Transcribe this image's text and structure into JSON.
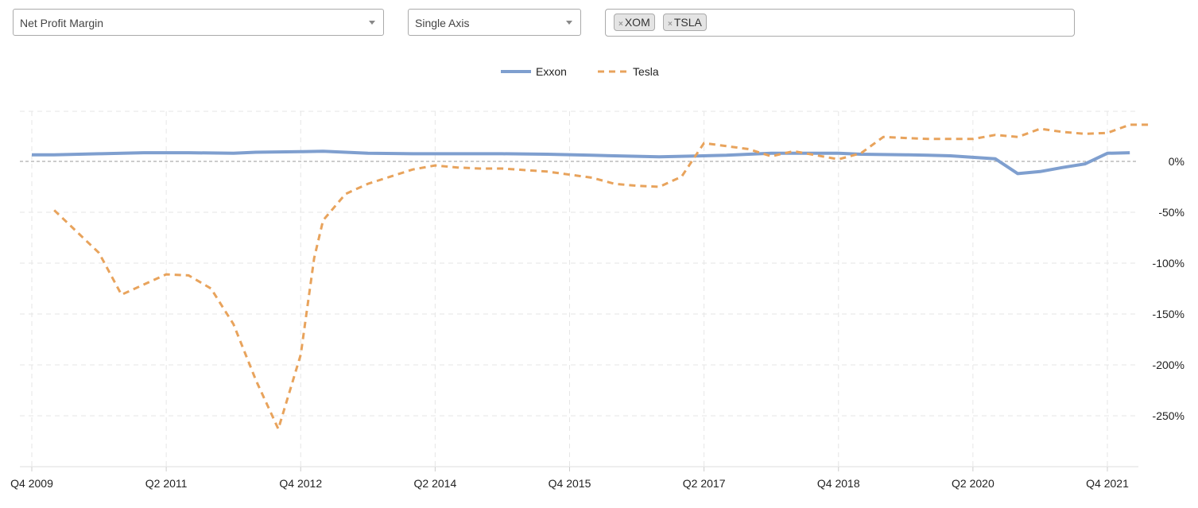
{
  "controls": {
    "metric": {
      "selected": "Net Profit Margin"
    },
    "axis_mode": {
      "selected": "Single Axis"
    },
    "tickers": [
      {
        "remove_icon": "×",
        "label": "XOM"
      },
      {
        "remove_icon": "×",
        "label": "TSLA"
      }
    ]
  },
  "chart_data": {
    "type": "line",
    "title": "",
    "xlabel": "",
    "ylabel": "",
    "legend_position": "top-center",
    "grid": true,
    "x_tick_labels": [
      "Q4 2009",
      "Q2 2011",
      "Q4 2012",
      "Q2 2014",
      "Q4 2015",
      "Q2 2017",
      "Q4 2018",
      "Q2 2020",
      "Q4 2021"
    ],
    "x_ticks": [
      2009.75,
      2011.25,
      2012.75,
      2014.25,
      2015.75,
      2017.25,
      2018.75,
      2020.25,
      2021.75
    ],
    "x_range": [
      2009.75,
      2022.0
    ],
    "y_ticks": [
      0,
      -50,
      -100,
      -150,
      -200,
      -250
    ],
    "y_tick_labels": [
      "0%",
      "-50%",
      "-100%",
      "-150%",
      "-200%",
      "-250%"
    ],
    "y_range": [
      -300,
      50
    ],
    "y_unit": "%",
    "series": [
      {
        "name": "Exxon",
        "color": "#7f9fcf",
        "style": "solid",
        "points": [
          [
            2009.75,
            6.5
          ],
          [
            2010.0,
            6.5
          ],
          [
            2010.5,
            7.5
          ],
          [
            2011.0,
            8.5
          ],
          [
            2011.25,
            8.5
          ],
          [
            2011.5,
            8.5
          ],
          [
            2012.0,
            8.0
          ],
          [
            2012.25,
            9.0
          ],
          [
            2012.75,
            9.5
          ],
          [
            2013.0,
            10.0
          ],
          [
            2013.5,
            8.0
          ],
          [
            2014.0,
            7.5
          ],
          [
            2014.5,
            7.5
          ],
          [
            2015.0,
            7.5
          ],
          [
            2015.5,
            7.0
          ],
          [
            2016.0,
            6.0
          ],
          [
            2016.5,
            5.0
          ],
          [
            2016.75,
            4.5
          ],
          [
            2017.0,
            5.0
          ],
          [
            2017.5,
            6.0
          ],
          [
            2017.75,
            7.0
          ],
          [
            2018.0,
            8.0
          ],
          [
            2018.5,
            8.0
          ],
          [
            2018.75,
            8.0
          ],
          [
            2019.0,
            7.0
          ],
          [
            2019.5,
            6.5
          ],
          [
            2019.75,
            6.0
          ],
          [
            2020.0,
            5.5
          ],
          [
            2020.25,
            4.0
          ],
          [
            2020.5,
            2.5
          ],
          [
            2020.75,
            -12.0
          ],
          [
            2021.0,
            -10.0
          ],
          [
            2021.25,
            -6.0
          ],
          [
            2021.5,
            -2.5
          ],
          [
            2021.75,
            8.0
          ],
          [
            2022.0,
            8.5
          ]
        ]
      },
      {
        "name": "Tesla",
        "color": "#e8a35c",
        "style": "dashed",
        "points": [
          [
            2010.0,
            -48
          ],
          [
            2010.5,
            -90
          ],
          [
            2010.75,
            -131
          ],
          [
            2011.0,
            -121
          ],
          [
            2011.25,
            -111
          ],
          [
            2011.5,
            -112
          ],
          [
            2011.75,
            -125
          ],
          [
            2012.0,
            -160
          ],
          [
            2012.25,
            -215
          ],
          [
            2012.5,
            -263
          ],
          [
            2012.75,
            -190
          ],
          [
            2012.9,
            -95
          ],
          [
            2013.0,
            -58
          ],
          [
            2013.25,
            -32
          ],
          [
            2013.5,
            -22
          ],
          [
            2013.75,
            -15
          ],
          [
            2014.0,
            -8
          ],
          [
            2014.25,
            -4
          ],
          [
            2014.5,
            -6
          ],
          [
            2014.75,
            -7
          ],
          [
            2015.0,
            -7
          ],
          [
            2015.5,
            -10
          ],
          [
            2016.0,
            -16
          ],
          [
            2016.25,
            -22
          ],
          [
            2016.5,
            -24
          ],
          [
            2016.75,
            -25
          ],
          [
            2017.0,
            -15
          ],
          [
            2017.25,
            18
          ],
          [
            2017.5,
            15
          ],
          [
            2017.75,
            12
          ],
          [
            2018.0,
            5
          ],
          [
            2018.25,
            10
          ],
          [
            2018.5,
            6
          ],
          [
            2018.75,
            2
          ],
          [
            2019.0,
            8
          ],
          [
            2019.25,
            24
          ],
          [
            2019.5,
            23
          ],
          [
            2019.75,
            22
          ],
          [
            2020.0,
            22
          ],
          [
            2020.25,
            22
          ],
          [
            2020.5,
            26
          ],
          [
            2020.75,
            24
          ],
          [
            2021.0,
            32
          ],
          [
            2021.25,
            29
          ],
          [
            2021.5,
            27
          ],
          [
            2021.75,
            28
          ],
          [
            2022.0,
            36
          ],
          [
            2022.25,
            36
          ]
        ]
      }
    ]
  }
}
